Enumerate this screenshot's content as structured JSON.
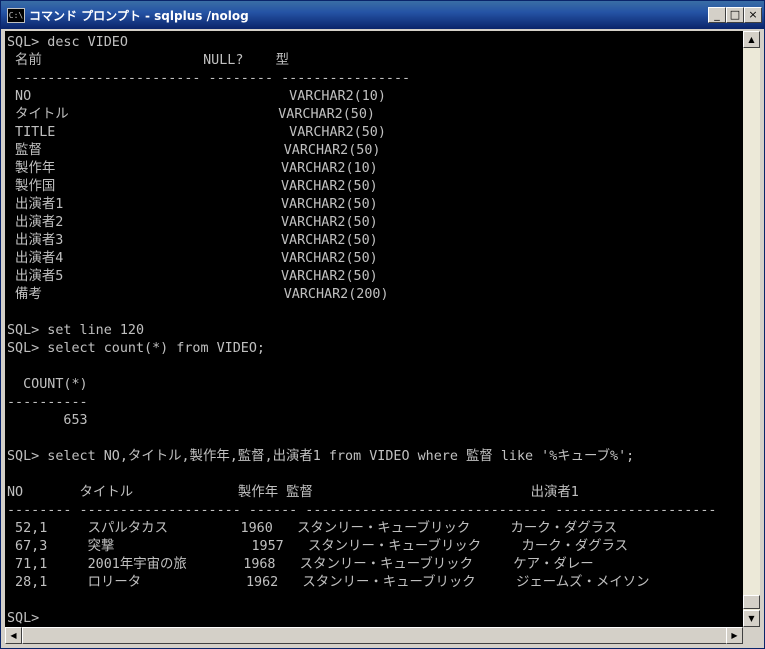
{
  "window": {
    "title": "コマンド プロンプト - sqlplus /nolog"
  },
  "icons": {
    "app": "cmd-icon",
    "minimize": "_",
    "maximize": "□",
    "close": "×",
    "up": "▲",
    "down": "▼",
    "left": "◀",
    "right": "▶"
  },
  "console": {
    "lines": [
      "SQL> desc VIDEO",
      " 名前                    NULL?    型",
      " ----------------------- -------- ----------------",
      " NO                                VARCHAR2(10)",
      " タイトル                          VARCHAR2(50)",
      " TITLE                             VARCHAR2(50)",
      " 監督                              VARCHAR2(50)",
      " 製作年                            VARCHAR2(10)",
      " 製作国                            VARCHAR2(50)",
      " 出演者1                           VARCHAR2(50)",
      " 出演者2                           VARCHAR2(50)",
      " 出演者3                           VARCHAR2(50)",
      " 出演者4                           VARCHAR2(50)",
      " 出演者5                           VARCHAR2(50)",
      " 備考                              VARCHAR2(200)",
      "",
      "SQL> set line 120",
      "SQL> select count(*) from VIDEO;",
      "",
      "  COUNT(*)",
      "----------",
      "       653",
      "",
      "SQL> select NO,タイトル,製作年,監督,出演者1 from VIDEO where 監督 like '%キューブ%';",
      "",
      "NO       タイトル             製作年 監督                           出演者1",
      "-------- -------------------- ------ ------------------------------ --------------------",
      " 52,1     スパルタカス         1960   スタンリー・キューブリック     カーク・ダグラス",
      " 67,3     突撃                 1957   スタンリー・キューブリック     カーク・ダグラス",
      " 71,1     2001年宇宙の旅       1968   スタンリー・キューブリック     ケア・ダレー",
      " 28,1     ロリータ             1962   スタンリー・キューブリック     ジェームズ・メイソン",
      "",
      "SQL>"
    ]
  }
}
